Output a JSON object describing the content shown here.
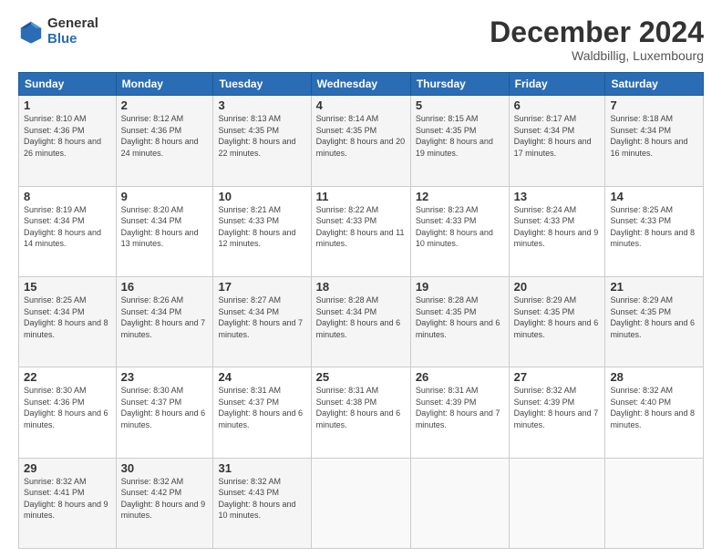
{
  "logo": {
    "general": "General",
    "blue": "Blue"
  },
  "header": {
    "month": "December 2024",
    "location": "Waldbillig, Luxembourg"
  },
  "days_of_week": [
    "Sunday",
    "Monday",
    "Tuesday",
    "Wednesday",
    "Thursday",
    "Friday",
    "Saturday"
  ],
  "weeks": [
    [
      {
        "day": "1",
        "sunrise": "Sunrise: 8:10 AM",
        "sunset": "Sunset: 4:36 PM",
        "daylight": "Daylight: 8 hours and 26 minutes."
      },
      {
        "day": "2",
        "sunrise": "Sunrise: 8:12 AM",
        "sunset": "Sunset: 4:36 PM",
        "daylight": "Daylight: 8 hours and 24 minutes."
      },
      {
        "day": "3",
        "sunrise": "Sunrise: 8:13 AM",
        "sunset": "Sunset: 4:35 PM",
        "daylight": "Daylight: 8 hours and 22 minutes."
      },
      {
        "day": "4",
        "sunrise": "Sunrise: 8:14 AM",
        "sunset": "Sunset: 4:35 PM",
        "daylight": "Daylight: 8 hours and 20 minutes."
      },
      {
        "day": "5",
        "sunrise": "Sunrise: 8:15 AM",
        "sunset": "Sunset: 4:35 PM",
        "daylight": "Daylight: 8 hours and 19 minutes."
      },
      {
        "day": "6",
        "sunrise": "Sunrise: 8:17 AM",
        "sunset": "Sunset: 4:34 PM",
        "daylight": "Daylight: 8 hours and 17 minutes."
      },
      {
        "day": "7",
        "sunrise": "Sunrise: 8:18 AM",
        "sunset": "Sunset: 4:34 PM",
        "daylight": "Daylight: 8 hours and 16 minutes."
      }
    ],
    [
      {
        "day": "8",
        "sunrise": "Sunrise: 8:19 AM",
        "sunset": "Sunset: 4:34 PM",
        "daylight": "Daylight: 8 hours and 14 minutes."
      },
      {
        "day": "9",
        "sunrise": "Sunrise: 8:20 AM",
        "sunset": "Sunset: 4:34 PM",
        "daylight": "Daylight: 8 hours and 13 minutes."
      },
      {
        "day": "10",
        "sunrise": "Sunrise: 8:21 AM",
        "sunset": "Sunset: 4:33 PM",
        "daylight": "Daylight: 8 hours and 12 minutes."
      },
      {
        "day": "11",
        "sunrise": "Sunrise: 8:22 AM",
        "sunset": "Sunset: 4:33 PM",
        "daylight": "Daylight: 8 hours and 11 minutes."
      },
      {
        "day": "12",
        "sunrise": "Sunrise: 8:23 AM",
        "sunset": "Sunset: 4:33 PM",
        "daylight": "Daylight: 8 hours and 10 minutes."
      },
      {
        "day": "13",
        "sunrise": "Sunrise: 8:24 AM",
        "sunset": "Sunset: 4:33 PM",
        "daylight": "Daylight: 8 hours and 9 minutes."
      },
      {
        "day": "14",
        "sunrise": "Sunrise: 8:25 AM",
        "sunset": "Sunset: 4:33 PM",
        "daylight": "Daylight: 8 hours and 8 minutes."
      }
    ],
    [
      {
        "day": "15",
        "sunrise": "Sunrise: 8:25 AM",
        "sunset": "Sunset: 4:34 PM",
        "daylight": "Daylight: 8 hours and 8 minutes."
      },
      {
        "day": "16",
        "sunrise": "Sunrise: 8:26 AM",
        "sunset": "Sunset: 4:34 PM",
        "daylight": "Daylight: 8 hours and 7 minutes."
      },
      {
        "day": "17",
        "sunrise": "Sunrise: 8:27 AM",
        "sunset": "Sunset: 4:34 PM",
        "daylight": "Daylight: 8 hours and 7 minutes."
      },
      {
        "day": "18",
        "sunrise": "Sunrise: 8:28 AM",
        "sunset": "Sunset: 4:34 PM",
        "daylight": "Daylight: 8 hours and 6 minutes."
      },
      {
        "day": "19",
        "sunrise": "Sunrise: 8:28 AM",
        "sunset": "Sunset: 4:35 PM",
        "daylight": "Daylight: 8 hours and 6 minutes."
      },
      {
        "day": "20",
        "sunrise": "Sunrise: 8:29 AM",
        "sunset": "Sunset: 4:35 PM",
        "daylight": "Daylight: 8 hours and 6 minutes."
      },
      {
        "day": "21",
        "sunrise": "Sunrise: 8:29 AM",
        "sunset": "Sunset: 4:35 PM",
        "daylight": "Daylight: 8 hours and 6 minutes."
      }
    ],
    [
      {
        "day": "22",
        "sunrise": "Sunrise: 8:30 AM",
        "sunset": "Sunset: 4:36 PM",
        "daylight": "Daylight: 8 hours and 6 minutes."
      },
      {
        "day": "23",
        "sunrise": "Sunrise: 8:30 AM",
        "sunset": "Sunset: 4:37 PM",
        "daylight": "Daylight: 8 hours and 6 minutes."
      },
      {
        "day": "24",
        "sunrise": "Sunrise: 8:31 AM",
        "sunset": "Sunset: 4:37 PM",
        "daylight": "Daylight: 8 hours and 6 minutes."
      },
      {
        "day": "25",
        "sunrise": "Sunrise: 8:31 AM",
        "sunset": "Sunset: 4:38 PM",
        "daylight": "Daylight: 8 hours and 6 minutes."
      },
      {
        "day": "26",
        "sunrise": "Sunrise: 8:31 AM",
        "sunset": "Sunset: 4:39 PM",
        "daylight": "Daylight: 8 hours and 7 minutes."
      },
      {
        "day": "27",
        "sunrise": "Sunrise: 8:32 AM",
        "sunset": "Sunset: 4:39 PM",
        "daylight": "Daylight: 8 hours and 7 minutes."
      },
      {
        "day": "28",
        "sunrise": "Sunrise: 8:32 AM",
        "sunset": "Sunset: 4:40 PM",
        "daylight": "Daylight: 8 hours and 8 minutes."
      }
    ],
    [
      {
        "day": "29",
        "sunrise": "Sunrise: 8:32 AM",
        "sunset": "Sunset: 4:41 PM",
        "daylight": "Daylight: 8 hours and 9 minutes."
      },
      {
        "day": "30",
        "sunrise": "Sunrise: 8:32 AM",
        "sunset": "Sunset: 4:42 PM",
        "daylight": "Daylight: 8 hours and 9 minutes."
      },
      {
        "day": "31",
        "sunrise": "Sunrise: 8:32 AM",
        "sunset": "Sunset: 4:43 PM",
        "daylight": "Daylight: 8 hours and 10 minutes."
      },
      null,
      null,
      null,
      null
    ]
  ]
}
